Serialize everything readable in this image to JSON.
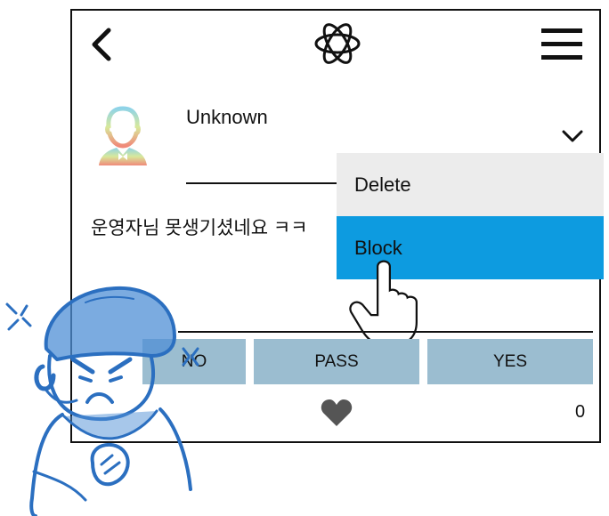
{
  "header": {
    "back_icon": "chevron-left-icon",
    "logo_icon": "atom-icon",
    "menu_icon": "hamburger-menu-icon"
  },
  "post": {
    "username": "Unknown",
    "avatar_icon": "user-avatar-icon",
    "options_icon": "chevron-down-icon",
    "message": "운영자님 못생기셨네요 ㅋㅋ"
  },
  "dropdown": {
    "items": [
      {
        "label": "Delete"
      },
      {
        "label": "Block"
      }
    ],
    "highlight_color": "#0d9be0"
  },
  "vote": {
    "no_label": "NO",
    "pass_label": "PASS",
    "yes_label": "YES",
    "button_color": "#9bbdd0"
  },
  "likes": {
    "icon": "heart-icon",
    "count": "0"
  },
  "illustration": {
    "character_icon": "angry-character-illustration",
    "cursor_icon": "hand-pointer-icon"
  }
}
